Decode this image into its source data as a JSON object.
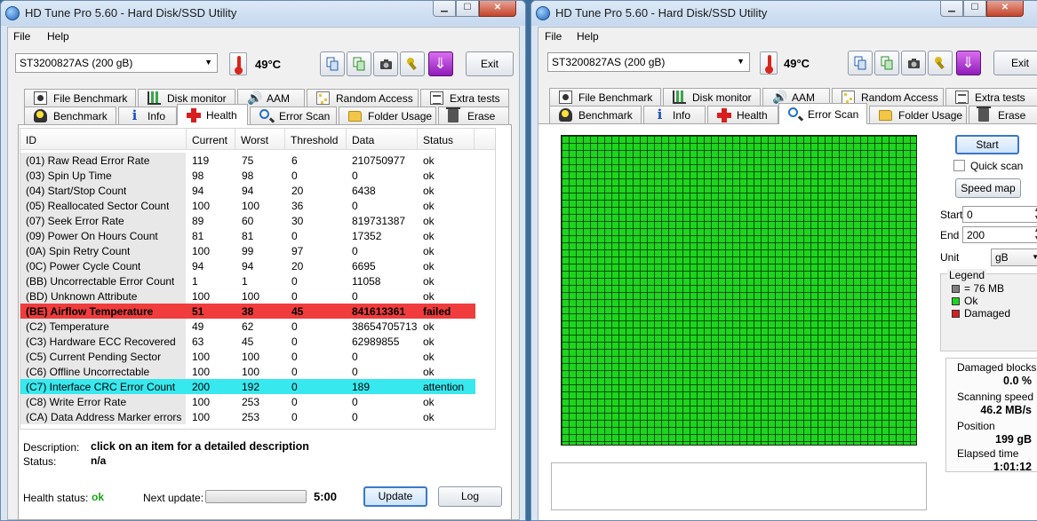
{
  "app": {
    "title": "HD Tune Pro 5.60 - Hard Disk/SSD Utility",
    "menu": [
      "File",
      "Help"
    ],
    "drive": "ST3200827AS (200 gB)",
    "temperature": "49°C",
    "exit_label": "Exit"
  },
  "tabs": {
    "top_row": [
      "File Benchmark",
      "Disk monitor",
      "AAM",
      "Random Access",
      "Extra tests"
    ],
    "bottom_row": [
      "Benchmark",
      "Info",
      "Health",
      "Error Scan",
      "Folder Usage",
      "Erase"
    ]
  },
  "health": {
    "columns": [
      "ID",
      "Current",
      "Worst",
      "Threshold",
      "Data",
      "Status"
    ],
    "rows": [
      {
        "id": "(01) Raw Read Error Rate",
        "current": "119",
        "worst": "75",
        "threshold": "6",
        "data": "210750977",
        "status": "ok"
      },
      {
        "id": "(03) Spin Up Time",
        "current": "98",
        "worst": "98",
        "threshold": "0",
        "data": "0",
        "status": "ok"
      },
      {
        "id": "(04) Start/Stop Count",
        "current": "94",
        "worst": "94",
        "threshold": "20",
        "data": "6438",
        "status": "ok"
      },
      {
        "id": "(05) Reallocated Sector Count",
        "current": "100",
        "worst": "100",
        "threshold": "36",
        "data": "0",
        "status": "ok"
      },
      {
        "id": "(07) Seek Error Rate",
        "current": "89",
        "worst": "60",
        "threshold": "30",
        "data": "819731387",
        "status": "ok"
      },
      {
        "id": "(09) Power On Hours Count",
        "current": "81",
        "worst": "81",
        "threshold": "0",
        "data": "17352",
        "status": "ok"
      },
      {
        "id": "(0A) Spin Retry Count",
        "current": "100",
        "worst": "99",
        "threshold": "97",
        "data": "0",
        "status": "ok"
      },
      {
        "id": "(0C) Power Cycle Count",
        "current": "94",
        "worst": "94",
        "threshold": "20",
        "data": "6695",
        "status": "ok"
      },
      {
        "id": "(BB) Uncorrectable Error Count",
        "current": "1",
        "worst": "1",
        "threshold": "0",
        "data": "11058",
        "status": "ok"
      },
      {
        "id": "(BD) Unknown Attribute",
        "current": "100",
        "worst": "100",
        "threshold": "0",
        "data": "0",
        "status": "ok"
      },
      {
        "id": "(BE) Airflow Temperature",
        "current": "51",
        "worst": "38",
        "threshold": "45",
        "data": "841613361",
        "status": "failed"
      },
      {
        "id": "(C2) Temperature",
        "current": "49",
        "worst": "62",
        "threshold": "0",
        "data": "38654705713",
        "status": "ok"
      },
      {
        "id": "(C3) Hardware ECC Recovered",
        "current": "63",
        "worst": "45",
        "threshold": "0",
        "data": "62989855",
        "status": "ok"
      },
      {
        "id": "(C5) Current Pending Sector",
        "current": "100",
        "worst": "100",
        "threshold": "0",
        "data": "0",
        "status": "ok"
      },
      {
        "id": "(C6) Offline Uncorrectable",
        "current": "100",
        "worst": "100",
        "threshold": "0",
        "data": "0",
        "status": "ok"
      },
      {
        "id": "(C7) Interface CRC Error Count",
        "current": "200",
        "worst": "192",
        "threshold": "0",
        "data": "189",
        "status": "attention"
      },
      {
        "id": "(C8) Write Error Rate",
        "current": "100",
        "worst": "253",
        "threshold": "0",
        "data": "0",
        "status": "ok"
      },
      {
        "id": "(CA) Data Address Marker errors",
        "current": "100",
        "worst": "253",
        "threshold": "0",
        "data": "0",
        "status": "ok"
      }
    ],
    "description_label": "Description:",
    "description_value": "click on an item for a detailed description",
    "status_label": "Status:",
    "status_value": "n/a",
    "health_status_label": "Health status:",
    "health_status_value": "ok",
    "next_update_label": "Next update:",
    "next_update_value": "5:00",
    "update_button": "Update",
    "log_button": "Log"
  },
  "error_scan": {
    "start_button": "Start",
    "quick_scan_label": "Quick scan",
    "quick_scan_checked": false,
    "speed_map_button": "Speed map",
    "start_label": "Start",
    "start_value": "0",
    "end_label": "End",
    "end_value": "200",
    "unit_label": "Unit",
    "unit_value": "gB",
    "legend_title": "Legend",
    "legend_items": [
      {
        "label": "= 76 MB",
        "color": "#7f7f7f"
      },
      {
        "label": "Ok",
        "color": "#1ed41e"
      },
      {
        "label": "Damaged",
        "color": "#d81e1e"
      }
    ],
    "damaged_blocks_label": "Damaged blocks",
    "damaged_blocks_value": "0.0 %",
    "scanning_speed_label": "Scanning speed",
    "scanning_speed_value": "46.2 MB/s",
    "position_label": "Position",
    "position_value": "199 gB",
    "elapsed_label": "Elapsed time",
    "elapsed_value": "1:01:12"
  },
  "colors": {
    "failed_row": "#f03c3c",
    "attention_row": "#37e8ee",
    "ok_block": "#1ed41e",
    "health_ok_text": "#15a515"
  }
}
